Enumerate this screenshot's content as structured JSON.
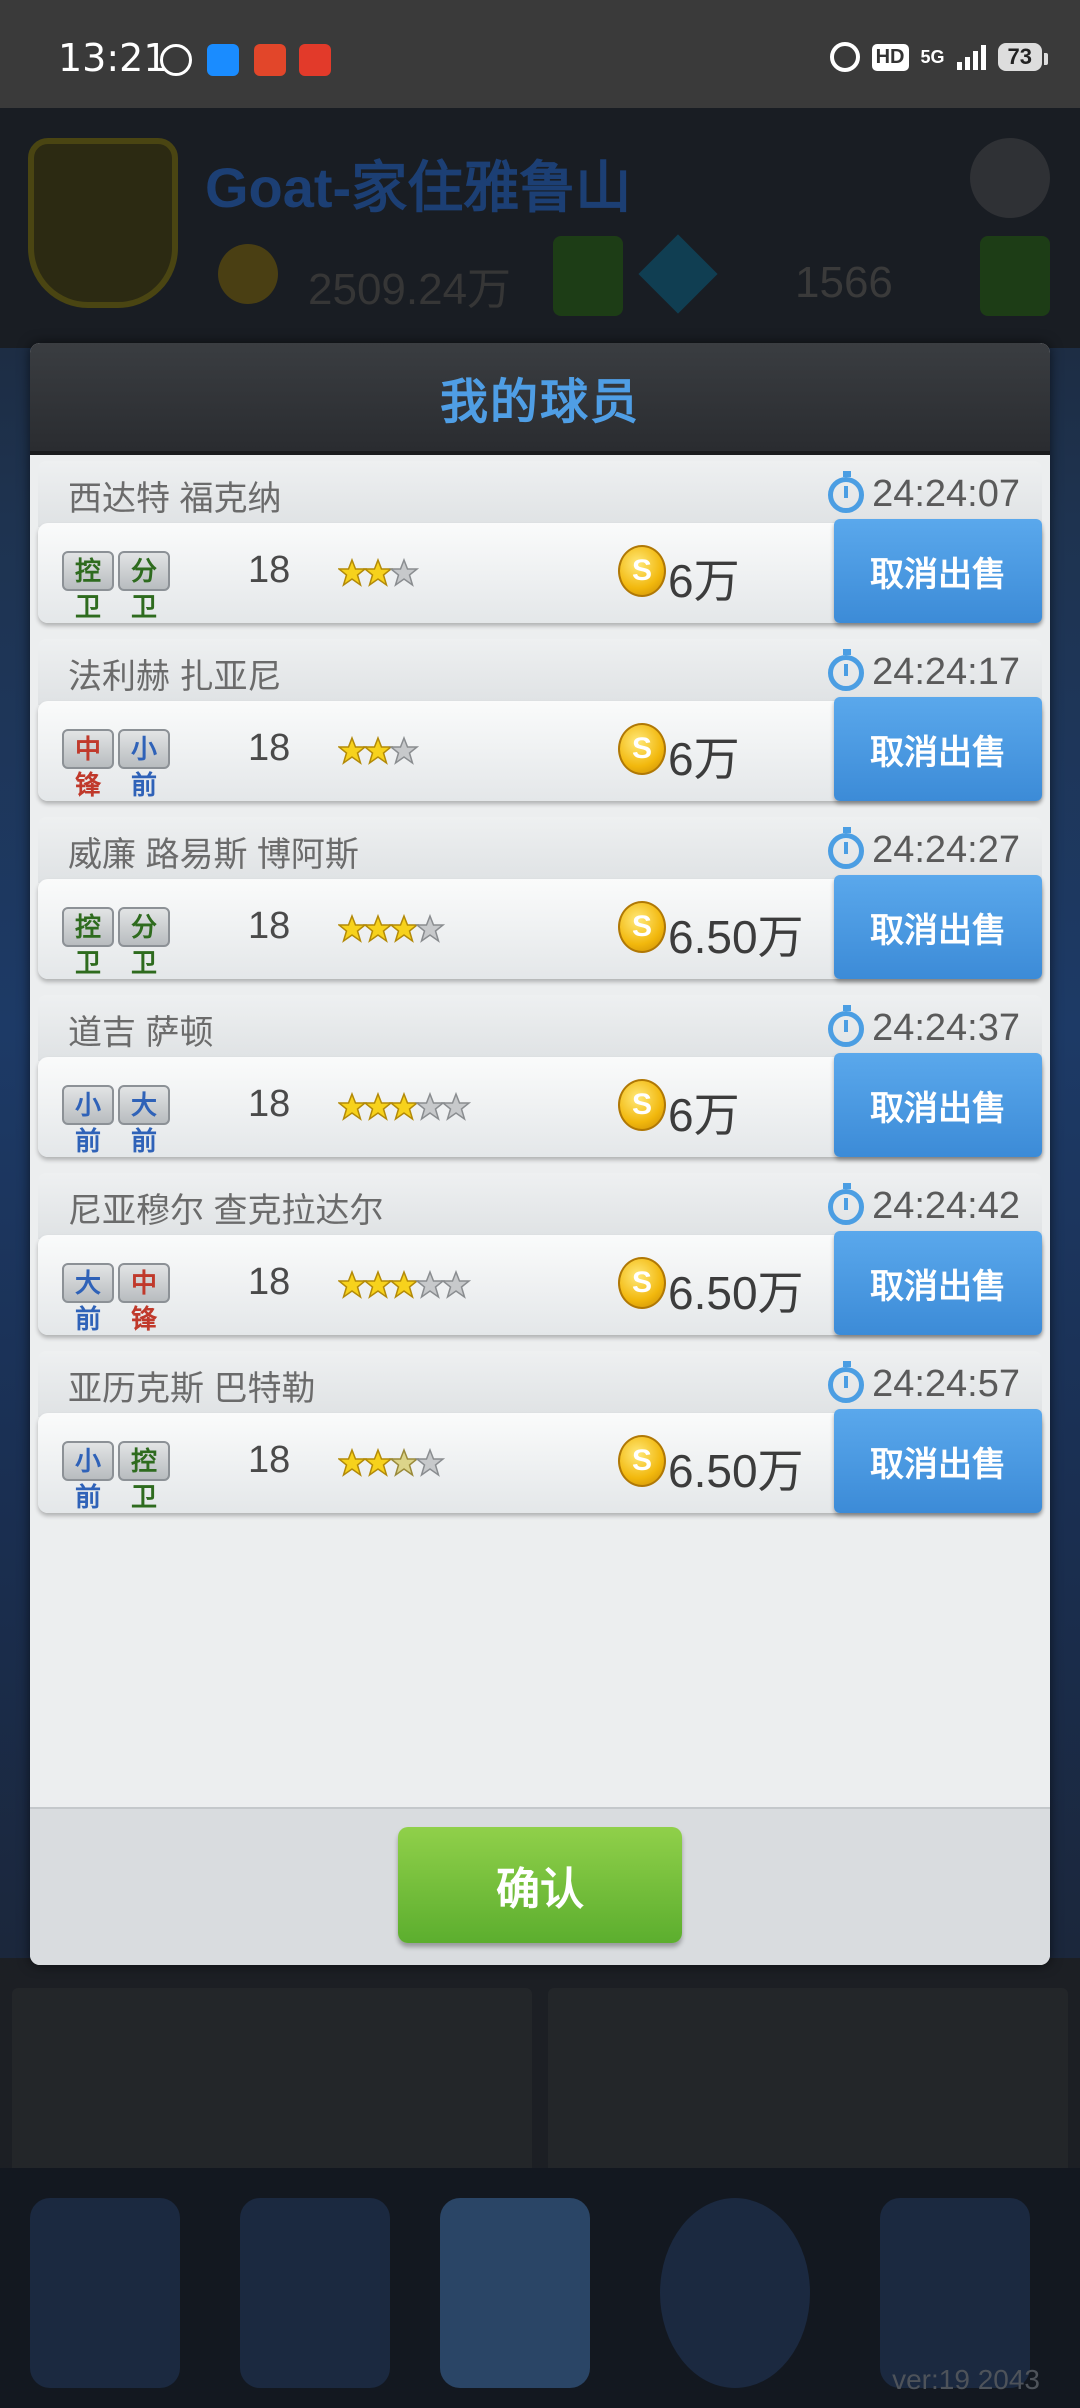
{
  "status_bar": {
    "time": "13:21",
    "hd_label": "HD",
    "network_label": "5G",
    "battery": "73"
  },
  "background": {
    "club_name": "Goat-家住雅鲁山",
    "coins": "2509.24万",
    "gems": "1566",
    "version": "ver:19  2043"
  },
  "dialog": {
    "title": "我的球员",
    "confirm_label": "确认",
    "players": [
      {
        "name": "西达特 福克纳",
        "timer": "24:24:07",
        "positions": [
          {
            "label": "控卫",
            "color": "#2e6b1e"
          },
          {
            "label": "分卫",
            "color": "#2e6b1e"
          }
        ],
        "age": "18",
        "stars_full": 2,
        "stars_half": 0,
        "stars_max": 3,
        "price": "6万",
        "cancel_label": "取消出售"
      },
      {
        "name": "法利赫 扎亚尼",
        "timer": "24:24:17",
        "positions": [
          {
            "label": "中锋",
            "color": "#c0392b"
          },
          {
            "label": "小前",
            "color": "#2f62b8"
          }
        ],
        "age": "18",
        "stars_full": 2,
        "stars_half": 0,
        "stars_max": 3,
        "price": "6万",
        "cancel_label": "取消出售"
      },
      {
        "name": "威廉 路易斯 博阿斯",
        "timer": "24:24:27",
        "positions": [
          {
            "label": "控卫",
            "color": "#2e6b1e"
          },
          {
            "label": "分卫",
            "color": "#2e6b1e"
          }
        ],
        "age": "18",
        "stars_full": 3,
        "stars_half": 0,
        "stars_max": 4,
        "price": "6.50万",
        "cancel_label": "取消出售"
      },
      {
        "name": "道吉 萨顿",
        "timer": "24:24:37",
        "positions": [
          {
            "label": "小前",
            "color": "#2f62b8"
          },
          {
            "label": "大前",
            "color": "#2f62b8"
          }
        ],
        "age": "18",
        "stars_full": 3,
        "stars_half": 0,
        "stars_max": 5,
        "price": "6万",
        "cancel_label": "取消出售"
      },
      {
        "name": "尼亚穆尔 查克拉达尔",
        "timer": "24:24:42",
        "positions": [
          {
            "label": "大前",
            "color": "#2f62b8"
          },
          {
            "label": "中锋",
            "color": "#c0392b"
          }
        ],
        "age": "18",
        "stars_full": 3,
        "stars_half": 0,
        "stars_max": 5,
        "price": "6.50万",
        "cancel_label": "取消出售"
      },
      {
        "name": "亚历克斯 巴特勒",
        "timer": "24:24:57",
        "positions": [
          {
            "label": "小前",
            "color": "#2f62b8"
          },
          {
            "label": "控卫",
            "color": "#2e6b1e"
          }
        ],
        "age": "18",
        "stars_full": 2,
        "stars_half": 1,
        "stars_max": 4,
        "price": "6.50万",
        "cancel_label": "取消出售"
      }
    ]
  },
  "colors": {
    "title_blue": "#4f9ee5",
    "cancel_blue": "#3c8bd7",
    "confirm_green": "#6cbd36",
    "timer_icon": "#4b9ee3"
  }
}
